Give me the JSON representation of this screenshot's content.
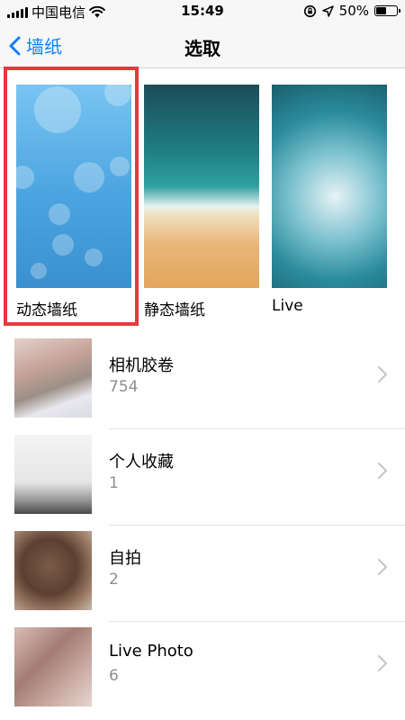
{
  "status_bar": {
    "carrier": "中国电信",
    "time": "15:49",
    "battery": "50%",
    "battery_level": 0.5
  },
  "nav": {
    "back_label": "墙纸",
    "title": "选取"
  },
  "wallpapers": [
    {
      "label": "动态墙纸",
      "selected": true
    },
    {
      "label": "静态墙纸",
      "selected": false
    },
    {
      "label": "Live",
      "selected": false
    }
  ],
  "albums": [
    {
      "name": "相机胶卷",
      "count": "754"
    },
    {
      "name": "个人收藏",
      "count": "1"
    },
    {
      "name": "自拍",
      "count": "2"
    },
    {
      "name": "Live Photo",
      "count": "6"
    }
  ],
  "colors": {
    "accent": "#147efb",
    "highlight": "#e8373d",
    "secondary_text": "#8e8e93"
  }
}
